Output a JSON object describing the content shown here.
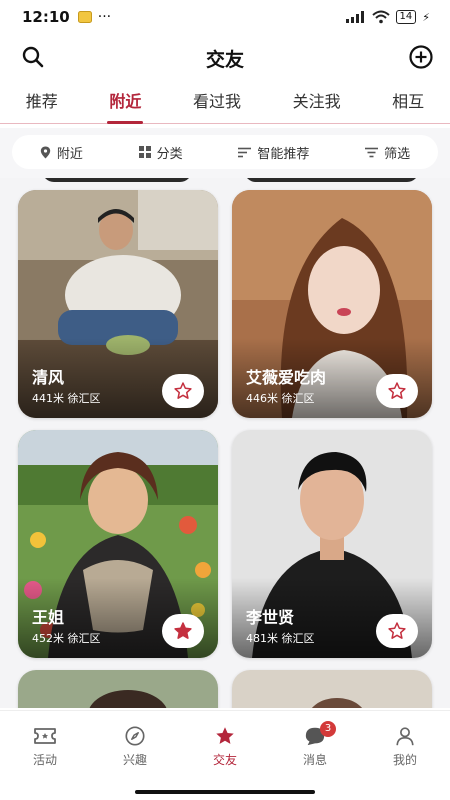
{
  "status_bar": {
    "time": "12:10",
    "dots": "···",
    "battery": "14"
  },
  "header": {
    "title": "交友"
  },
  "tabs": [
    {
      "label": "推荐",
      "active": false
    },
    {
      "label": "附近",
      "active": true
    },
    {
      "label": "看过我",
      "active": false
    },
    {
      "label": "关注我",
      "active": false
    },
    {
      "label": "相互",
      "active": false
    }
  ],
  "filters": {
    "nearby": "附近",
    "category": "分类",
    "sort": "智能推荐",
    "filter": "筛选"
  },
  "cards": [
    {
      "name": "清风",
      "meta": "441米 徐汇区",
      "favorited": false
    },
    {
      "name": "艾薇爱吃肉",
      "meta": "446米 徐汇区",
      "favorited": false
    },
    {
      "name": "王姐",
      "meta": "452米 徐汇区",
      "favorited": true
    },
    {
      "name": "李世贤",
      "meta": "481米 徐汇区",
      "favorited": false
    }
  ],
  "bottom_nav": [
    {
      "label": "活动",
      "icon": "ticket-icon"
    },
    {
      "label": "兴趣",
      "icon": "compass-icon"
    },
    {
      "label": "交友",
      "icon": "star-icon",
      "active": true
    },
    {
      "label": "消息",
      "icon": "chat-bubble-icon",
      "badge": "3"
    },
    {
      "label": "我的",
      "icon": "person-icon"
    }
  ],
  "colors": {
    "accent": "#b3263b",
    "badge": "#d33a3a"
  }
}
